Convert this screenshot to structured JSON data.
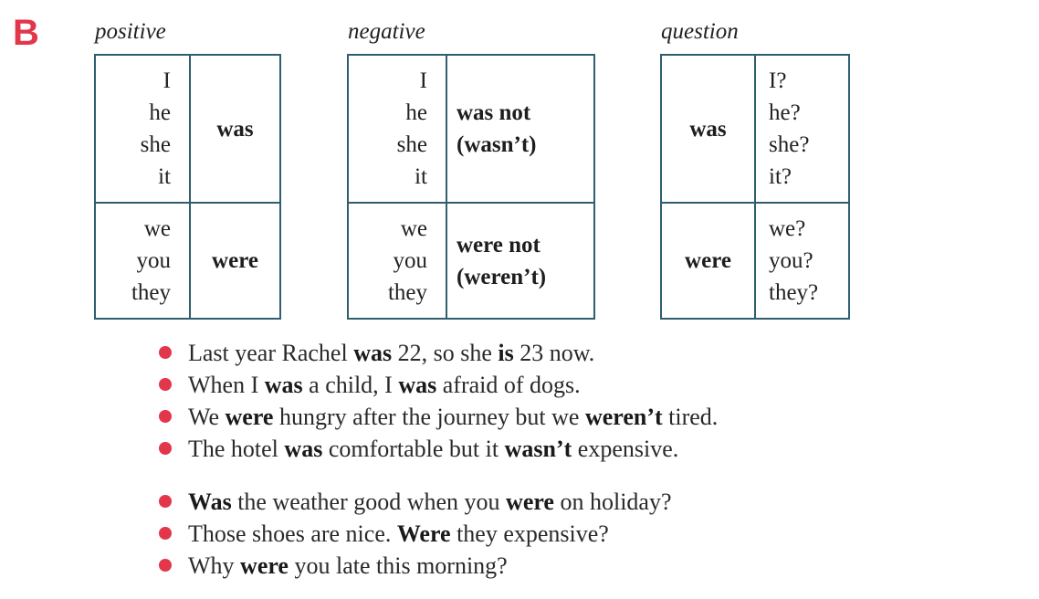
{
  "section_letter": "B",
  "tables": {
    "positive": {
      "heading": "positive",
      "singular_pronouns": [
        "I",
        "he",
        "she",
        "it"
      ],
      "singular_verb": "was",
      "plural_pronouns": [
        "we",
        "you",
        "they"
      ],
      "plural_verb": "were"
    },
    "negative": {
      "heading": "negative",
      "singular_pronouns": [
        "I",
        "he",
        "she",
        "it"
      ],
      "singular_verb": "was not",
      "singular_verb_short": "(wasn’t)",
      "plural_pronouns": [
        "we",
        "you",
        "they"
      ],
      "plural_verb": "were not",
      "plural_verb_short": "(weren’t)"
    },
    "question": {
      "heading": "question",
      "singular_verb": "was",
      "singular_pronouns": [
        "I?",
        "he?",
        "she?",
        "it?"
      ],
      "plural_verb": "were",
      "plural_pronouns": [
        "we?",
        "you?",
        "they?"
      ]
    }
  },
  "examples": {
    "group1": [
      {
        "p1": "Last year Rachel ",
        "b1": "was",
        "p2": " 22, so she ",
        "b2": "is",
        "p3": " 23 now."
      },
      {
        "p1": "When I ",
        "b1": "was",
        "p2": " a child, I ",
        "b2": "was",
        "p3": " afraid of dogs."
      },
      {
        "p1": "We ",
        "b1": "were",
        "p2": " hungry after the journey but we ",
        "b2": "weren’t",
        "p3": " tired."
      },
      {
        "p1": "The hotel ",
        "b1": "was",
        "p2": " comfortable but it ",
        "b2": "wasn’t",
        "p3": " expensive."
      }
    ],
    "group2": [
      {
        "p1": "",
        "b1": "Was",
        "p2": " the weather good when you ",
        "b2": "were",
        "p3": " on holiday?"
      },
      {
        "p1": "Those shoes are nice. ",
        "b1": "Were",
        "p2": " they expensive?",
        "b2": "",
        "p3": ""
      },
      {
        "p1": "Why ",
        "b1": "were",
        "p2": " you late this morning?",
        "b2": "",
        "p3": ""
      }
    ]
  },
  "colors": {
    "accent": "#e2374a",
    "table_border": "#2f5e6e",
    "text": "#222222"
  }
}
